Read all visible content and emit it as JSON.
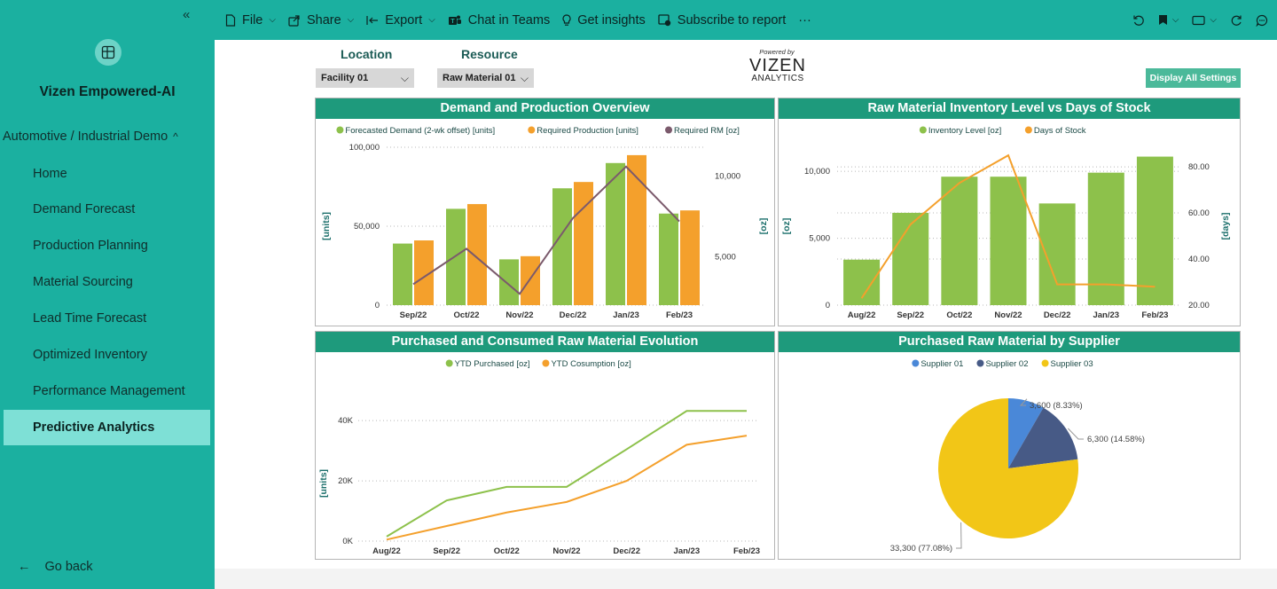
{
  "sidebar": {
    "collapse_icon": "double-chevron-left-icon",
    "logo_icon": "app-grid-icon",
    "app_title": "Vizen Empowered-AI",
    "section": "Automotive / Industrial Demo",
    "items": [
      {
        "label": "Home",
        "active": false
      },
      {
        "label": "Demand Forecast",
        "active": false
      },
      {
        "label": "Production Planning",
        "active": false
      },
      {
        "label": "Material Sourcing",
        "active": false
      },
      {
        "label": "Lead Time Forecast",
        "active": false
      },
      {
        "label": "Optimized Inventory",
        "active": false
      },
      {
        "label": "Performance Management",
        "active": false
      },
      {
        "label": "Predictive Analytics",
        "active": true
      }
    ],
    "go_back": "Go back"
  },
  "toolbar": {
    "file": "File",
    "share": "Share",
    "export": "Export",
    "chat": "Chat in Teams",
    "insights": "Get insights",
    "subscribe": "Subscribe to report",
    "more": "···"
  },
  "filters": {
    "location_label": "Location",
    "location_value": "Facility 01",
    "resource_label": "Resource",
    "resource_value": "Raw Material 01"
  },
  "branding": {
    "powered_by": "Powered by",
    "wordmark": "VIZEN",
    "sub": "ANALYTICS"
  },
  "display_all_button": "Display All Settings",
  "colors": {
    "accent": "#1bb0a0",
    "panel_header": "#1e9a7c",
    "green": "#8dc14b",
    "orange": "#f4a02c",
    "purple": "#7b5a6c",
    "supplier01": "#4a88d8",
    "supplier02": "#475a86",
    "supplier03": "#f2c617"
  },
  "chart_data": [
    {
      "type": "bar",
      "title": "Demand and Production Overview",
      "legend": [
        "Forecasted Demand (2-wk offset) [units]",
        "Required Production [units]",
        "Required RM [oz]"
      ],
      "categories": [
        "Sep/22",
        "Oct/22",
        "Nov/22",
        "Dec/22",
        "Jan/23",
        "Feb/23"
      ],
      "series": [
        {
          "name": "Forecasted Demand (2-wk offset) [units]",
          "axis": "left",
          "values": [
            39000,
            61000,
            29000,
            74000,
            90000,
            58000
          ]
        },
        {
          "name": "Required Production [units]",
          "axis": "left",
          "values": [
            41000,
            64000,
            31000,
            78000,
            95000,
            60000
          ]
        },
        {
          "name": "Required RM [oz]",
          "type": "line",
          "axis": "right",
          "values": [
            3300,
            5500,
            2700,
            7400,
            10600,
            7200
          ]
        }
      ],
      "ylabel": "[units]",
      "y2label": "[oz]",
      "ylim": [
        0,
        100000
      ],
      "y2lim": [
        2000,
        11800
      ],
      "yticks": [
        "0",
        "50,000",
        "100,000"
      ],
      "y2ticks": [
        "5,000",
        "10,000"
      ]
    },
    {
      "type": "bar",
      "title": "Raw Material Inventory Level vs Days of Stock",
      "legend": [
        "Inventory Level [oz]",
        "Days of Stock"
      ],
      "categories": [
        "Aug/22",
        "Sep/22",
        "Oct/22",
        "Nov/22",
        "Dec/22",
        "Jan/23",
        "Feb/23"
      ],
      "series": [
        {
          "name": "Inventory Level [oz]",
          "axis": "left",
          "values": [
            3400,
            6900,
            9600,
            9600,
            7600,
            9900,
            11100
          ]
        },
        {
          "name": "Days of Stock",
          "type": "line",
          "axis": "right",
          "values": [
            23,
            55,
            73,
            85,
            29,
            29,
            28
          ]
        }
      ],
      "ylabel": "[oz]",
      "y2label": "[days]",
      "ylim": [
        0,
        11800
      ],
      "y2lim": [
        20,
        88.5
      ],
      "yticks": [
        "0",
        "5,000",
        "10,000"
      ],
      "y2ticks": [
        "20.00",
        "40.00",
        "60.00",
        "80.00"
      ]
    },
    {
      "type": "line",
      "title": "Purchased and Consumed Raw Material Evolution",
      "legend": [
        "YTD Purchased [oz]",
        "YTD Cosumption [oz]"
      ],
      "categories": [
        "Aug/22",
        "Sep/22",
        "Oct/22",
        "Nov/22",
        "Dec/22",
        "Jan/23",
        "Feb/23"
      ],
      "series": [
        {
          "name": "YTD Purchased [oz]",
          "values": [
            1500,
            13500,
            18000,
            18000,
            30500,
            43200,
            43200
          ]
        },
        {
          "name": "YTD Cosumption [oz]",
          "values": [
            500,
            5000,
            9500,
            13000,
            20000,
            32000,
            35000
          ]
        }
      ],
      "ylabel": "[units]",
      "ylim": [
        0,
        48000
      ],
      "yticks": [
        "0K",
        "20K",
        "40K"
      ]
    },
    {
      "type": "pie",
      "title": "Purchased Raw Material by Supplier",
      "legend": [
        "Supplier 01",
        "Supplier 02",
        "Supplier 03"
      ],
      "slices": [
        {
          "name": "Supplier 01",
          "value": 3600,
          "label": "3,600 (8.33%)"
        },
        {
          "name": "Supplier 02",
          "value": 6300,
          "label": "6,300 (14.58%)"
        },
        {
          "name": "Supplier 03",
          "value": 33300,
          "label": "33,300 (77.08%)"
        }
      ]
    }
  ]
}
